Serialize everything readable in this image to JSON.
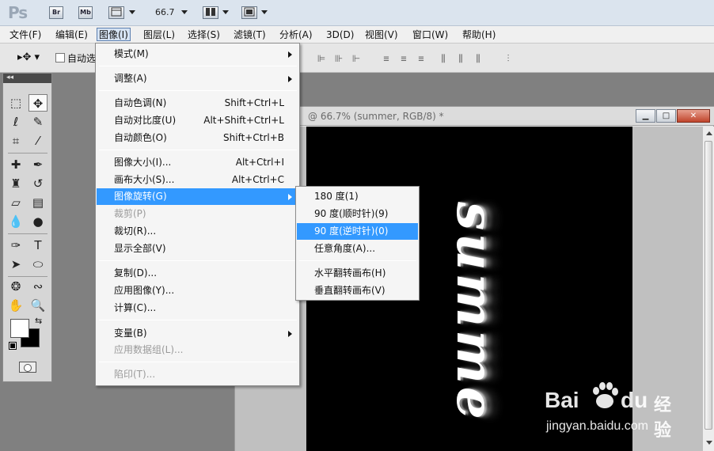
{
  "titlebar": {
    "logo": "Ps",
    "bridge_label": "Br",
    "minibridge_label": "Mb",
    "zoom": "66.7"
  },
  "menubar": {
    "items": [
      "文件(F)",
      "编辑(E)",
      "图像(I)",
      "图层(L)",
      "选择(S)",
      "滤镜(T)",
      "分析(A)",
      "3D(D)",
      "视图(V)",
      "窗口(W)",
      "帮助(H)"
    ],
    "active": "图像(I)"
  },
  "options_bar": {
    "auto_select_label": "自动选"
  },
  "document": {
    "title": "@ 66.7% (summer, RGB/8) *",
    "canvas_text": "summe",
    "canvas_background": "#000000",
    "text_color": "#ffffff"
  },
  "image_menu": {
    "items": [
      {
        "label": "模式(M)",
        "submenu": true
      },
      {
        "label": "调整(A)",
        "submenu": true
      },
      {
        "label": "自动色调(N)",
        "shortcut": "Shift+Ctrl+L"
      },
      {
        "label": "自动对比度(U)",
        "shortcut": "Alt+Shift+Ctrl+L"
      },
      {
        "label": "自动颜色(O)",
        "shortcut": "Shift+Ctrl+B"
      },
      {
        "label": "图像大小(I)...",
        "shortcut": "Alt+Ctrl+I"
      },
      {
        "label": "画布大小(S)...",
        "shortcut": "Alt+Ctrl+C"
      },
      {
        "label": "图像旋转(G)",
        "submenu": true,
        "highlighted": true
      },
      {
        "label": "裁剪(P)",
        "disabled": true
      },
      {
        "label": "裁切(R)..."
      },
      {
        "label": "显示全部(V)"
      },
      {
        "label": "复制(D)..."
      },
      {
        "label": "应用图像(Y)..."
      },
      {
        "label": "计算(C)..."
      },
      {
        "label": "变量(B)",
        "submenu": true
      },
      {
        "label": "应用数据组(L)...",
        "disabled": true
      },
      {
        "label": "陷印(T)...",
        "disabled": true
      }
    ]
  },
  "rotate_submenu": {
    "items": [
      {
        "label": "180 度(1)"
      },
      {
        "label": "90 度(顺时针)(9)"
      },
      {
        "label": "90 度(逆时针)(0)",
        "highlighted": true
      },
      {
        "label": "任意角度(A)..."
      },
      {
        "label": "水平翻转画布(H)"
      },
      {
        "label": "垂直翻转画布(V)"
      }
    ]
  },
  "watermark": {
    "brand_left": "Bai",
    "brand_right": "du",
    "product": "经验",
    "url": "jingyan.baidu.com"
  },
  "colors": {
    "highlight": "#3399ff",
    "menubar_bg": "#f0f0f0",
    "workspace": "#808080"
  }
}
